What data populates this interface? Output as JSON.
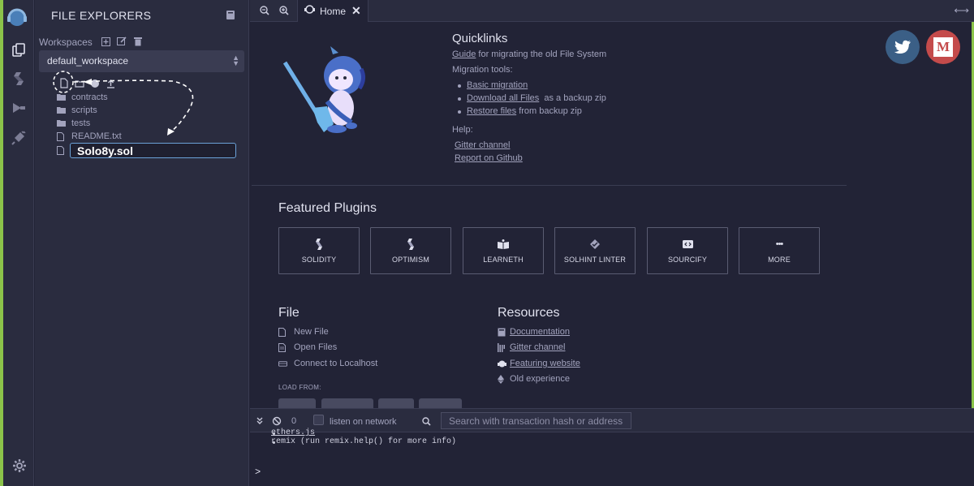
{
  "sidebar": {
    "title": "FILE EXPLORERS",
    "workspaces_label": "Workspaces",
    "workspace_selected": "default_workspace",
    "tree": [
      {
        "name": "contracts",
        "type": "folder"
      },
      {
        "name": "scripts",
        "type": "folder"
      },
      {
        "name": "tests",
        "type": "folder"
      },
      {
        "name": "README.txt",
        "type": "file"
      }
    ],
    "new_file_value": "Solo8y.sol"
  },
  "tabs": {
    "home_label": "Home",
    "close_glyph": "✕"
  },
  "quicklinks": {
    "title": "Quicklinks",
    "guide_link": "Guide",
    "guide_text": " for migrating the old File System",
    "migration_tools": "Migration tools:",
    "basic_migration": "Basic migration",
    "download_link": "Download all Files",
    "download_text": "  as a backup zip",
    "restore_link": "Restore files",
    "restore_text": " from backup zip",
    "help": "Help:",
    "gitter": "Gitter channel",
    "report": "Report on Github"
  },
  "social": {
    "twitter_color": "#3b5f86",
    "medium_color": "#c44b4b",
    "medium_letter": "M"
  },
  "featured": {
    "title": "Featured Plugins",
    "plugins": [
      "SOLIDITY",
      "OPTIMISM",
      "LEARNETH",
      "SOLHINT LINTER",
      "SOURCIFY",
      "MORE"
    ],
    "more_glyph": "•••"
  },
  "file_section": {
    "title": "File",
    "new_file": "New File",
    "open_files": "Open Files",
    "connect": "Connect to Localhost",
    "load_from": "LOAD FROM:"
  },
  "resources": {
    "title": "Resources",
    "documentation": "Documentation",
    "gitter": "Gitter channel",
    "featuring": "Featuring website",
    "old_experience": "Old experience"
  },
  "terminal": {
    "count": "0",
    "listen_label": "listen on network",
    "search_placeholder": "Search with transaction hash or address",
    "lines": [
      "ethers.js",
      "remix (run remix.help() for more info)"
    ],
    "prompt": ">"
  },
  "colors": {
    "background": "#222336",
    "panel": "#2a2c3f",
    "accent_edge": "#8bc34a",
    "focus_border": "#6ba2d8"
  }
}
